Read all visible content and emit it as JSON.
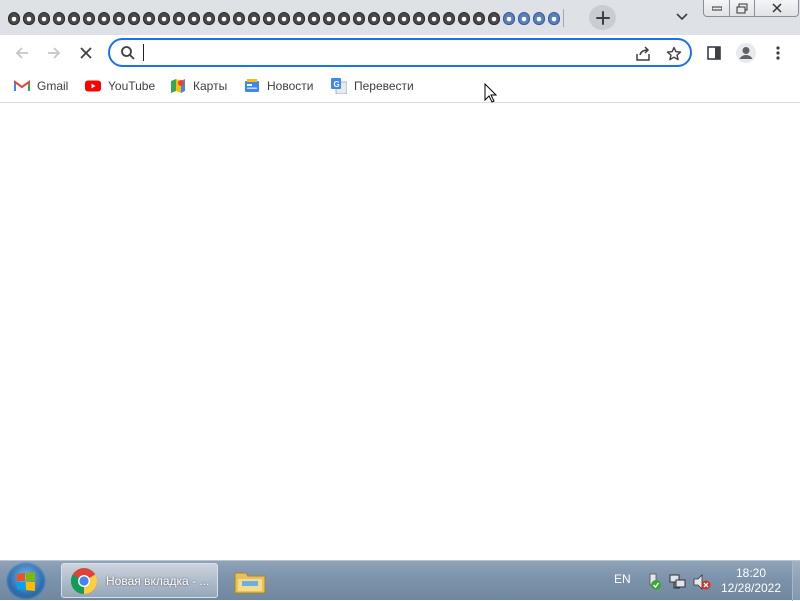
{
  "window": {
    "tab_count": 37,
    "tab_highlight_count": 4
  },
  "toolbar": {
    "back_icon": "arrow-left-icon",
    "forward_icon": "arrow-right-icon",
    "stop_icon": "close-icon",
    "omnibox": {
      "value": "",
      "placeholder": ""
    },
    "share_icon": "share-icon",
    "star_icon": "star-icon",
    "side_panel_icon": "side-panel-icon",
    "profile_icon": "profile-icon",
    "menu_icon": "more-vert-icon"
  },
  "bookmarks": [
    {
      "label": "Gmail",
      "icon": "gmail-icon"
    },
    {
      "label": "YouTube",
      "icon": "youtube-icon"
    },
    {
      "label": "Карты",
      "icon": "maps-icon"
    },
    {
      "label": "Новости",
      "icon": "news-icon"
    },
    {
      "label": "Перевести",
      "icon": "translate-icon"
    }
  ],
  "taskbar": {
    "chrome_task_label": "Новая вкладка - ...",
    "language": "EN",
    "time": "18:20",
    "date": "12/28/2022"
  },
  "colors": {
    "accent": "#1a73e8",
    "tabstrip": "#dee1e6",
    "taskbar": "#7c93ab"
  }
}
